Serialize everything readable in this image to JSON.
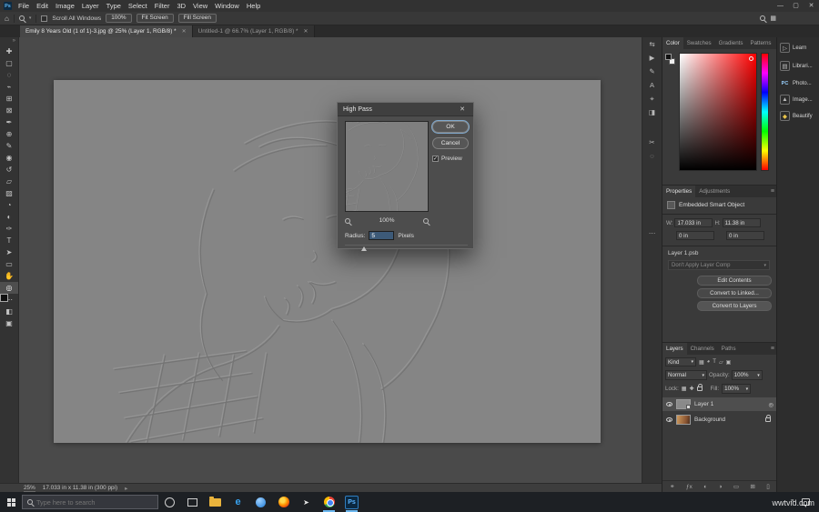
{
  "window_controls": {
    "minimize": "—",
    "maximize": "▢",
    "close": "✕"
  },
  "app": {
    "logo_text": "Ps"
  },
  "menubar": {
    "items": [
      "File",
      "Edit",
      "Image",
      "Layer",
      "Type",
      "Select",
      "Filter",
      "3D",
      "View",
      "Window",
      "Help"
    ]
  },
  "options_bar": {
    "scroll_all_windows": "Scroll All Windows",
    "zoom_100": "100%",
    "fit_screen": "Fit Screen",
    "fill_screen": "Fill Screen"
  },
  "document_tabs": {
    "close_glyph": "✕",
    "tabs": [
      {
        "label": "Emily 8 Years Old (1 of 1)-3.jpg @ 25% (Layer 1, RGB/8) *"
      },
      {
        "label": "Untitled-1 @ 66.7% (Layer 1, RGB/8) *"
      }
    ]
  },
  "tools": [
    {
      "name": "move-tool",
      "glyph": "✚"
    },
    {
      "name": "marquee-tool",
      "glyph": "▢"
    },
    {
      "name": "lasso-tool",
      "glyph": "◌"
    },
    {
      "name": "quick-selection-tool",
      "glyph": "⌁"
    },
    {
      "name": "crop-tool",
      "glyph": "⊞"
    },
    {
      "name": "frame-tool",
      "glyph": "⊠"
    },
    {
      "name": "eyedropper-tool",
      "glyph": "✒"
    },
    {
      "name": "healing-brush-tool",
      "glyph": "⊕"
    },
    {
      "name": "brush-tool",
      "glyph": "✎"
    },
    {
      "name": "clone-stamp-tool",
      "glyph": "◉"
    },
    {
      "name": "history-brush-tool",
      "glyph": "↺"
    },
    {
      "name": "eraser-tool",
      "glyph": "▱"
    },
    {
      "name": "gradient-tool",
      "glyph": "▨"
    },
    {
      "name": "blur-tool",
      "glyph": "◔"
    },
    {
      "name": "dodge-tool",
      "glyph": "◐"
    },
    {
      "name": "pen-tool",
      "glyph": "✑"
    },
    {
      "name": "type-tool",
      "glyph": "T"
    },
    {
      "name": "path-select-tool",
      "glyph": "➤"
    },
    {
      "name": "shape-tool",
      "glyph": "▭"
    },
    {
      "name": "hand-tool",
      "glyph": "✋"
    },
    {
      "name": "zoom-tool",
      "glyph": "◎"
    }
  ],
  "toolbar_extra": {
    "edit_toolbar": "⋯",
    "quick_mask": "◧",
    "screen_mode": "▣"
  },
  "dock_icons": [
    {
      "name": "panel-arrows-icon",
      "glyph": "⇆"
    },
    {
      "name": "actions-panel-icon",
      "glyph": "▶"
    },
    {
      "name": "brush-settings-icon",
      "glyph": "✎"
    },
    {
      "name": "character-panel-icon",
      "glyph": "A"
    },
    {
      "name": "navigator-icon",
      "glyph": "⌖"
    },
    {
      "name": "histogram-icon",
      "glyph": "◨"
    },
    {
      "name": "clip-icon",
      "glyph": "✂"
    },
    {
      "name": "shapes-icon",
      "glyph": "◌"
    },
    {
      "name": "more-panels-icon",
      "glyph": "⋯"
    }
  ],
  "dialog": {
    "title": "High Pass",
    "ok_label": "OK",
    "cancel_label": "Cancel",
    "preview_label": "Preview",
    "zoom_value": "100%",
    "radius_label": "Radius:",
    "radius_value": "5",
    "units_label": "Pixels",
    "close_glyph": "✕",
    "checkmark": "✓"
  },
  "color_panel": {
    "tabs": [
      "Color",
      "Swatches",
      "Gradients",
      "Patterns"
    ]
  },
  "properties_panel": {
    "tabs": [
      "Properties",
      "Adjustments"
    ],
    "object_type": "Embedded Smart Object",
    "w_label": "W:",
    "w_value": "17.033 in",
    "h_label": "H:",
    "h_value": "11.38 in",
    "x_value": "0 in",
    "y_value": "0 in",
    "file_name": "Layer 1.psb",
    "layer_comp": "Don't Apply Layer Comp",
    "edit_contents": "Edit Contents",
    "convert_linked": "Convert to Linked...",
    "convert_layers": "Convert to Layers"
  },
  "layers_panel": {
    "tabs": [
      "Layers",
      "Channels",
      "Paths"
    ],
    "kind_label": "Kind",
    "filter_icons": [
      {
        "name": "pixel-filter",
        "glyph": "▦"
      },
      {
        "name": "adjustment-filter",
        "glyph": "◕"
      },
      {
        "name": "type-filter",
        "glyph": "T"
      },
      {
        "name": "shape-filter",
        "glyph": "▱"
      },
      {
        "name": "smart-object-filter",
        "glyph": "▣"
      }
    ],
    "blend_mode": "Normal",
    "opacity_label": "Opacity:",
    "opacity_value": "100%",
    "lock_label": "Lock:",
    "fill_label": "Fill:",
    "fill_value": "100%",
    "layers": [
      {
        "name": "Layer 1"
      },
      {
        "name": "Background"
      }
    ],
    "bottom_icons": [
      {
        "name": "link-layers-icon",
        "glyph": "⚭"
      },
      {
        "name": "layer-style-icon",
        "glyph": "ƒx"
      },
      {
        "name": "layer-mask-icon",
        "glyph": "◐"
      },
      {
        "name": "adjustment-layer-icon",
        "glyph": "◑"
      },
      {
        "name": "layer-group-icon",
        "glyph": "▭"
      },
      {
        "name": "new-layer-icon",
        "glyph": "⊞"
      },
      {
        "name": "delete-layer-icon",
        "glyph": "▯"
      }
    ]
  },
  "right_rail": {
    "items": [
      {
        "label": "Learn",
        "glyph": "▷"
      },
      {
        "label": "Librari...",
        "glyph": "▤"
      },
      {
        "label": "Photo...",
        "glyph": "PC"
      },
      {
        "label": "Image...",
        "glyph": "▲"
      },
      {
        "label": "Beautify",
        "glyph": "◆"
      }
    ]
  },
  "status_bar": {
    "zoom": "25%",
    "doc_info": "17.033 in x 11.38 in (300 ppi)",
    "chevron": "▸"
  },
  "taskbar": {
    "search_placeholder": "Type here to search",
    "edge_label": "e",
    "ps_label": "Ps",
    "tray_chevron": "^"
  },
  "icons": {
    "home": "⌂",
    "dropdown_arrow": "▾",
    "panel_menu": "≡",
    "workspace": "▦",
    "double_chevron": "»",
    "smart_object_badge": "▣",
    "clipped_indicator": "◎"
  },
  "watermark": "wwtvid.com",
  "colors": {
    "accent_blue": "#31a8ff",
    "canvas_gray": "#858585",
    "pasteboard": "#4a4a4a"
  }
}
